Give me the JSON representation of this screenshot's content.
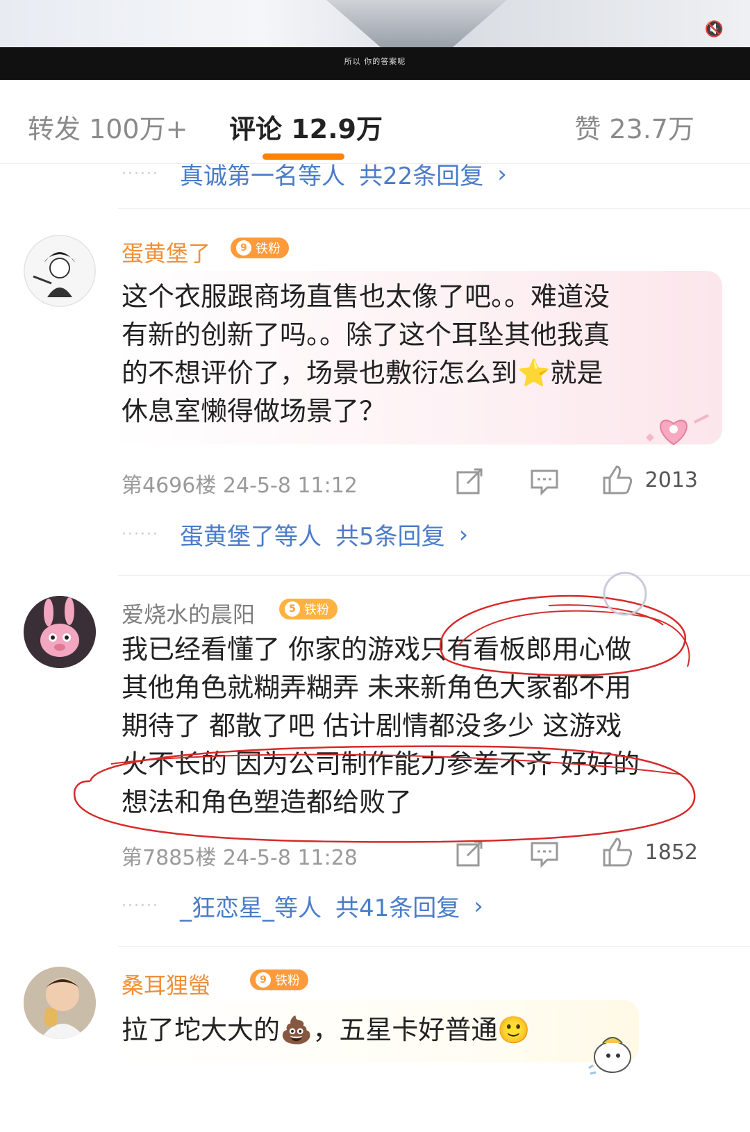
{
  "video": {
    "caption": "所以 你的答案呢"
  },
  "tabs": {
    "repost": "转发 100万+",
    "comment": "评论 12.9万",
    "like": "赞 23.7万"
  },
  "reply_rows": [
    {
      "names": "真诚第一名等人",
      "count": "共22条回复",
      "chevron": "›"
    },
    {
      "names": "蛋黄堡了等人",
      "count": "共5条回复",
      "chevron": "›"
    },
    {
      "names": "_狂恋星_等人",
      "count": "共41条回复",
      "chevron": "›"
    }
  ],
  "comments": [
    {
      "username": "蛋黄堡了",
      "username_color": "#f08f38",
      "badge_level": "9",
      "badge_text": "铁粉",
      "badge_color": "#ff9a3a",
      "lines": [
        "这个衣服跟商场直售也太像了吧。。难道没",
        "有新的创新了吗。。除了这个耳坠其他我真",
        "的不想评价了，场景也敷衍怎么到⭐就是",
        "休息室懒得做场景了？"
      ],
      "floor": "第4696楼",
      "time": "24-5-8 11:12",
      "likes": "2013"
    },
    {
      "username": "爱烧水的晨阳",
      "username_color": "#7d7d7d",
      "badge_level": "5",
      "badge_text": "铁粉",
      "badge_color": "#ffb23f",
      "lines": [
        "我已经看懂了 你家的游戏只有看板郎用心做",
        "其他角色就糊弄糊弄 未来新角色大家都不用",
        "期待了 都散了吧 估计剧情都没多少 这游戏",
        "火不长的 因为公司制作能力参差不齐 好好的",
        "想法和角色塑造都给败了"
      ],
      "floor": "第7885楼",
      "time": "24-5-8 11:28",
      "likes": "1852"
    },
    {
      "username": "桑耳狸螢",
      "username_color": "#f08f38",
      "badge_level": "9",
      "badge_text": "铁粉",
      "badge_color": "#ff9a3a",
      "lines": [
        "拉了坨大大的💩，五星卡好普通🙂"
      ]
    }
  ],
  "icons": {
    "share": "share-icon",
    "comment": "comment-icon",
    "like": "thumbs-up-icon"
  },
  "colors": {
    "accent": "#ff8200",
    "link": "#4a7cc9",
    "annotation": "#d62a2a"
  }
}
